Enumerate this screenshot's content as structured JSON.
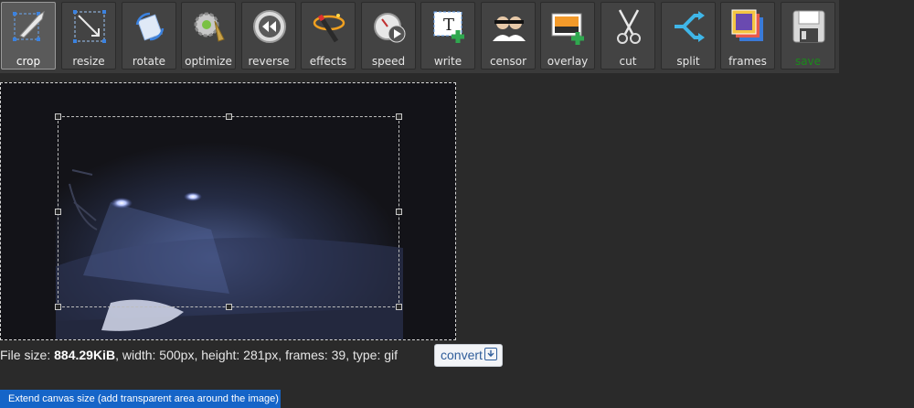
{
  "toolbar": {
    "tools": [
      {
        "id": "crop",
        "label": "crop",
        "icon": "crop-icon",
        "active": true
      },
      {
        "id": "resize",
        "label": "resize",
        "icon": "resize-icon"
      },
      {
        "id": "rotate",
        "label": "rotate",
        "icon": "rotate-icon"
      },
      {
        "id": "optimize",
        "label": "optimize",
        "icon": "optimize-icon"
      },
      {
        "id": "reverse",
        "label": "reverse",
        "icon": "reverse-icon"
      },
      {
        "id": "effects",
        "label": "effects",
        "icon": "effects-icon"
      },
      {
        "id": "speed",
        "label": "speed",
        "icon": "speed-icon"
      },
      {
        "id": "write",
        "label": "write",
        "icon": "write-icon"
      },
      {
        "id": "censor",
        "label": "censor",
        "icon": "censor-icon"
      },
      {
        "id": "overlay",
        "label": "overlay",
        "icon": "overlay-icon"
      },
      {
        "id": "cut",
        "label": "cut",
        "icon": "cut-icon"
      },
      {
        "id": "split",
        "label": "split",
        "icon": "split-icon"
      },
      {
        "id": "frames",
        "label": "frames",
        "icon": "frames-icon"
      },
      {
        "id": "save",
        "label": "save",
        "icon": "save-icon",
        "color": "#1b8a1b"
      }
    ]
  },
  "file_info": {
    "prefix": "File size: ",
    "size": "884.29KiB",
    "details": ", width: 500px, height: 281px, frames: 39, type: gif"
  },
  "convert_button": {
    "label": "convert",
    "icon": "download-icon"
  },
  "extend_canvas_button": {
    "label": "Extend canvas size (add transparent area around the image)"
  },
  "colors": {
    "accent": "#1565c8",
    "save_label": "#1b8a1b",
    "toolbar_bg": "#3a3a3a",
    "page_bg": "#2a2a2a"
  }
}
